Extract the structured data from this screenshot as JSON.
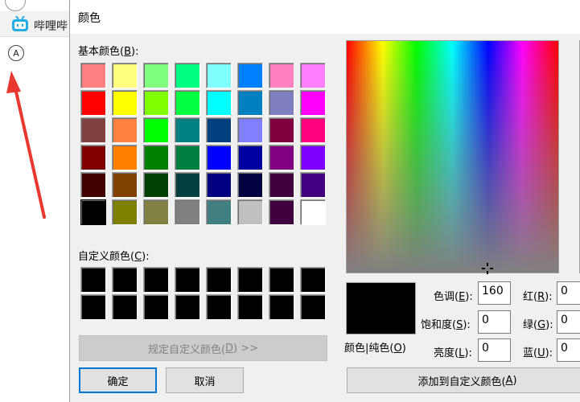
{
  "background_window": {
    "tab_label": "哔哩哔",
    "circle_letter": "A"
  },
  "dialog": {
    "title": "颜色",
    "basic_colors_label": "基本颜色(",
    "basic_colors_key": "B",
    "basic_colors_suffix": "):",
    "custom_colors_label": "自定义颜色(",
    "custom_colors_key": "C",
    "custom_colors_suffix": "):",
    "define_custom_button": "规定自定义颜色(",
    "define_custom_key": "D",
    "define_custom_suffix": ") >>",
    "ok_button": "确定",
    "cancel_button": "取消",
    "color_solid_label": "颜色|纯色(",
    "color_solid_key": "O",
    "color_solid_suffix": ")",
    "add_custom_button": "添加到自定义颜色(",
    "add_custom_key": "A",
    "add_custom_suffix": ")",
    "hue": {
      "label": "色调(",
      "key": "E",
      "suffix": "):",
      "value": "160"
    },
    "sat": {
      "label": "饱和度(",
      "key": "S",
      "suffix": "):",
      "value": "0"
    },
    "lum": {
      "label": "亮度(",
      "key": "L",
      "suffix": "):",
      "value": "0"
    },
    "red": {
      "label": "红(",
      "key": "R",
      "suffix": "):",
      "value": "0"
    },
    "green": {
      "label": "绿(",
      "key": "G",
      "suffix": "):",
      "value": "0"
    },
    "blue": {
      "label": "蓝(",
      "key": "U",
      "suffix": "):",
      "value": "0"
    }
  },
  "basic_colors": [
    "#ff8080",
    "#ffff80",
    "#80ff80",
    "#00ff80",
    "#80ffff",
    "#0080ff",
    "#ff80c0",
    "#ff80ff",
    "#ff0000",
    "#ffff00",
    "#80ff00",
    "#00ff40",
    "#00ffff",
    "#0080c0",
    "#8080c0",
    "#ff00ff",
    "#804040",
    "#ff8040",
    "#00ff00",
    "#008080",
    "#004080",
    "#8080ff",
    "#800040",
    "#ff0080",
    "#800000",
    "#ff8000",
    "#008000",
    "#008040",
    "#0000ff",
    "#0000a0",
    "#800080",
    "#8000ff",
    "#400000",
    "#804000",
    "#004000",
    "#004040",
    "#000080",
    "#000040",
    "#400040",
    "#400080",
    "#000000",
    "#808000",
    "#808040",
    "#808080",
    "#408080",
    "#c0c0c0",
    "#400040",
    "#ffffff"
  ],
  "selected_basic_index": 40,
  "custom_colors": [
    "#000000",
    "#000000",
    "#000000",
    "#000000",
    "#000000",
    "#000000",
    "#000000",
    "#000000",
    "#000000",
    "#000000",
    "#000000",
    "#000000",
    "#000000",
    "#000000",
    "#000000",
    "#000000"
  ],
  "colors": {
    "arrow": "#e8382f",
    "accent": "#0078d7",
    "bilibili": "#23ade5"
  }
}
